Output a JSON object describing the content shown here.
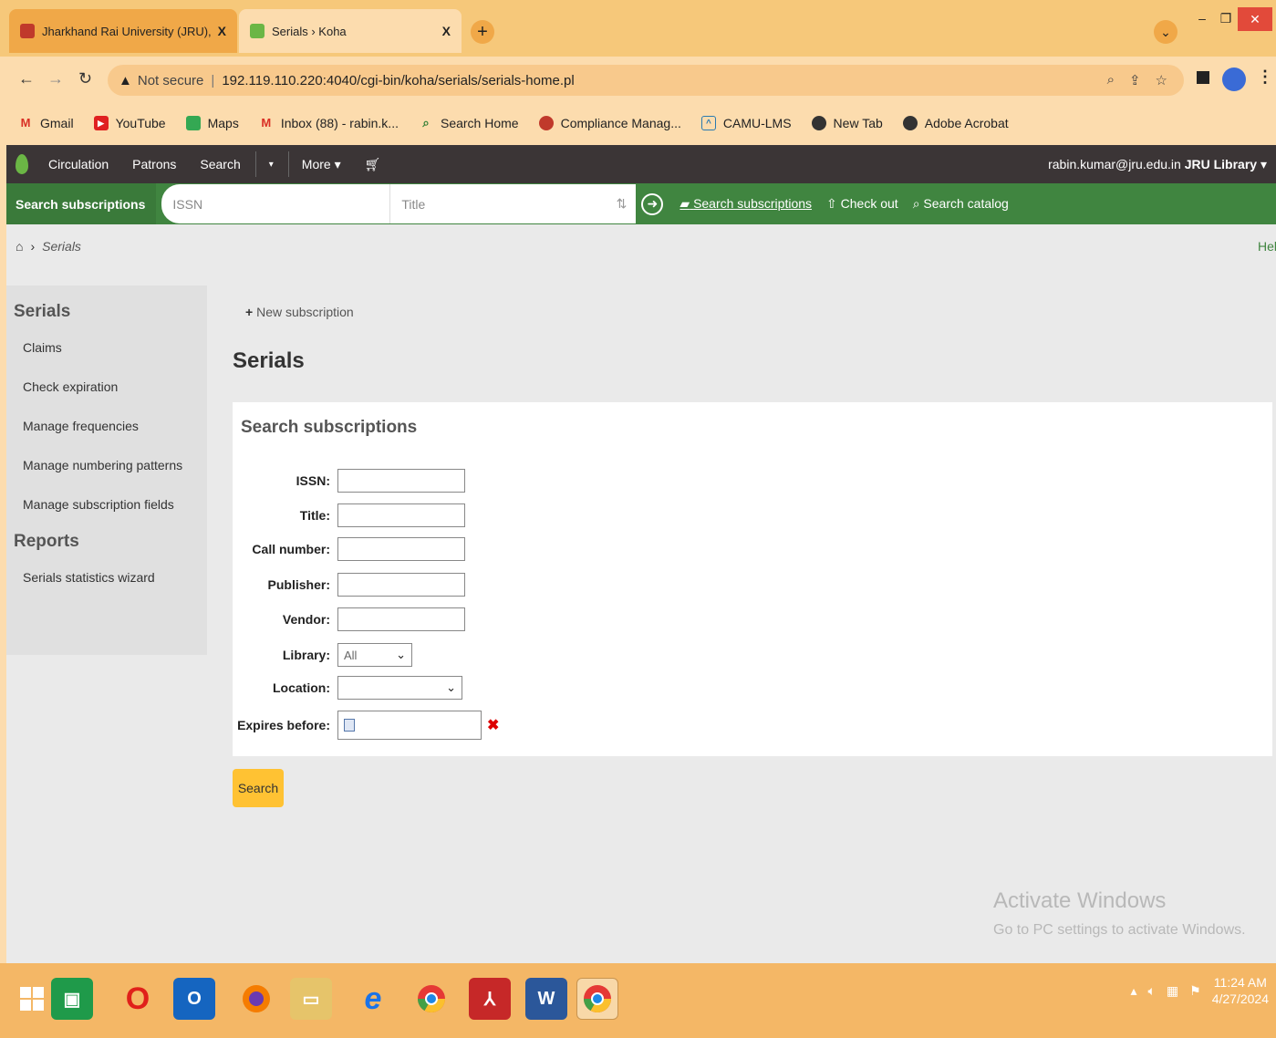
{
  "browser": {
    "tabs": [
      {
        "title": "Jharkhand Rai University (JRU), R",
        "close": "X"
      },
      {
        "title": "Serials › Koha",
        "close": "X"
      }
    ],
    "new_tab": "+",
    "address": {
      "warning": "▲",
      "not_secure": "Not secure",
      "separator": "|",
      "url": "192.119.110.220:4040/cgi-bin/koha/serials/serials-home.pl"
    },
    "bookmarks": [
      "Gmail",
      "YouTube",
      "Maps",
      "Inbox (88) - rabin.k...",
      "Search Home",
      "Compliance Manag...",
      "CAMU-LMS",
      "New Tab",
      "Adobe Acrobat"
    ]
  },
  "koha_nav": {
    "items": [
      "Circulation",
      "Patrons",
      "Search"
    ],
    "more": "More ▾",
    "user_email": "rabin.kumar@jru.edu.in",
    "library": "JRU Library",
    "library_caret": "▾"
  },
  "search_header": {
    "label": "Search subscriptions",
    "issn_placeholder": "ISSN",
    "title_placeholder": "Title",
    "links": [
      "Search subscriptions",
      "Check out",
      "Search catalog"
    ]
  },
  "breadcrumb": {
    "current": "Serials"
  },
  "help": "Help",
  "sidebar": {
    "heading_serials": "Serials",
    "serials_items": [
      "Claims",
      "Check expiration",
      "Manage frequencies",
      "Manage numbering patterns",
      "Manage subscription fields"
    ],
    "heading_reports": "Reports",
    "report_items": [
      "Serials statistics wizard"
    ]
  },
  "toolbar": {
    "new_subscription": "New subscription"
  },
  "page_title": "Serials",
  "form": {
    "title": "Search subscriptions",
    "issn_label": "ISSN:",
    "title_label": "Title:",
    "callnumber_label": "Call number:",
    "publisher_label": "Publisher:",
    "vendor_label": "Vendor:",
    "library_label": "Library:",
    "library_value": "All",
    "location_label": "Location:",
    "location_value": "",
    "expires_label": "Expires before:",
    "search_button": "Search"
  },
  "watermark": {
    "line1": "Activate Windows",
    "line2": "Go to PC settings to activate Windows."
  },
  "taskbar": {
    "time": "11:24 AM",
    "date": "4/27/2024"
  }
}
